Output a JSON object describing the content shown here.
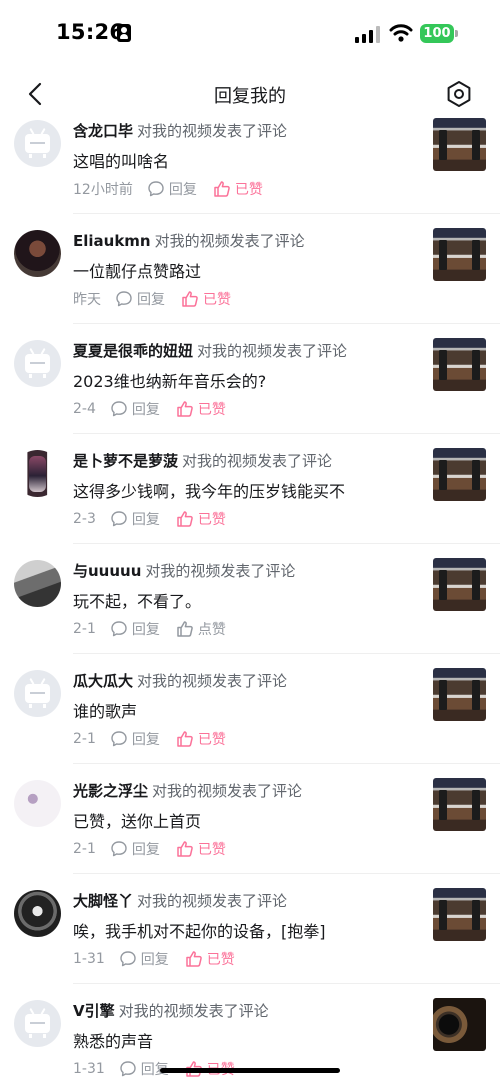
{
  "status_bar": {
    "time": "15:26",
    "battery": "100"
  },
  "nav": {
    "title": "回复我的"
  },
  "action_text": "对我的视频发表了评论",
  "reply_label": "回复",
  "liked_label": "已赞",
  "like_label": "点赞",
  "replies": [
    {
      "user": "含龙口毕",
      "text": "这唱的叫啥名",
      "time": "12小时前",
      "liked": true
    },
    {
      "user": "Eliaukmn",
      "text": "一位靓仔点赞路过",
      "time": "昨天",
      "liked": true
    },
    {
      "user": "夏夏是很乖的妞妞",
      "text": "2023维也纳新年音乐会的?",
      "time": "2-4",
      "liked": true
    },
    {
      "user": "是卜萝不是萝菠",
      "text": "这得多少钱啊，我今年的压岁钱能买不",
      "time": "2-3",
      "liked": true
    },
    {
      "user": "与uuuuu",
      "text": "玩不起，不看了。",
      "time": "2-1",
      "liked": false
    },
    {
      "user": "瓜大瓜大",
      "text": "谁的歌声",
      "time": "2-1",
      "liked": true
    },
    {
      "user": "光影之浮尘",
      "text": "已赞，送你上首页",
      "time": "2-1",
      "liked": true
    },
    {
      "user": "大脚怪丫",
      "text": "唉，我手机对不起你的设备，[抱拳]",
      "time": "1-31",
      "liked": true
    },
    {
      "user": "V引擎",
      "text": "熟悉的声音",
      "time": "1-31",
      "liked": true
    }
  ],
  "colors": {
    "accent_pink": "#fb7299",
    "secondary_text": "#9499a0",
    "battery_green": "#34c759"
  },
  "icons": {
    "back": "chevron-left-icon",
    "settings": "settings-icon",
    "reply": "comment-bubble-icon",
    "like": "thumbs-up-icon"
  }
}
